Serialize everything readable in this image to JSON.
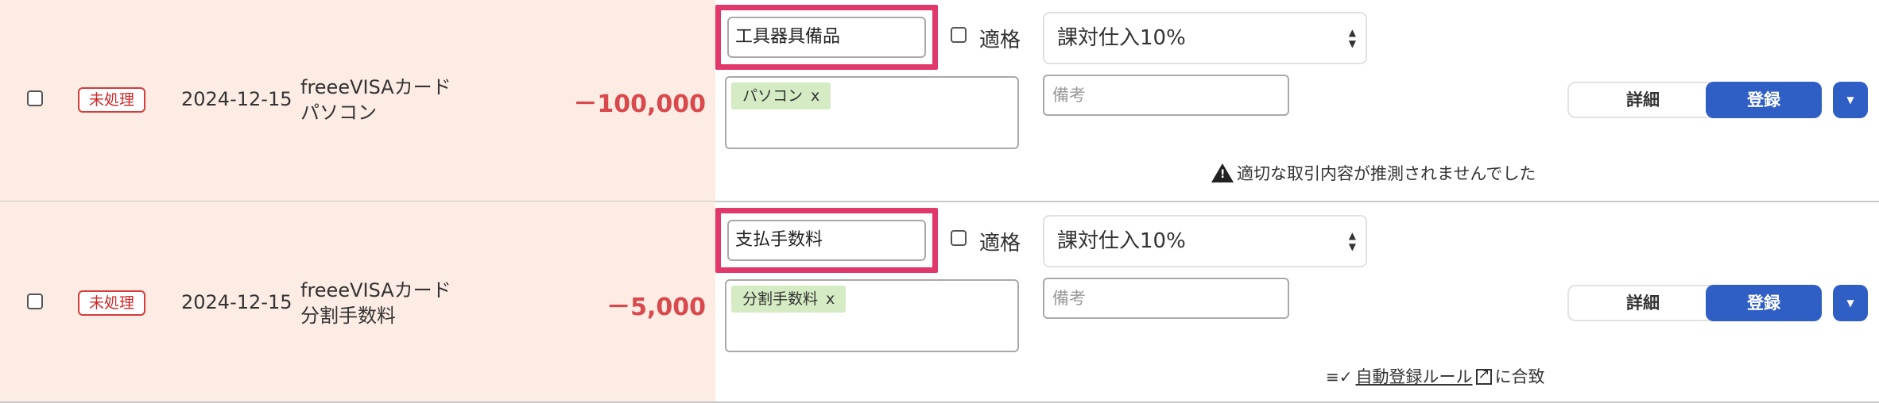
{
  "rows": [
    {
      "status": "未処理",
      "date": "2024-12-15",
      "desc_line1": "freeeVISAカード",
      "desc_line2": "パソコン",
      "amount": "－100,000",
      "account": "工具器具備品",
      "tekikaku_label": "適格",
      "tax": "課対仕入10%",
      "tag": "パソコン",
      "tag_remove": "x",
      "memo_placeholder": "備考",
      "detail_label": "詳細",
      "register_label": "登録",
      "note": "適切な取引内容が推測されませんでした"
    },
    {
      "status": "未処理",
      "date": "2024-12-15",
      "desc_line1": "freeeVISAカード",
      "desc_line2": "分割手数料",
      "amount": "－5,000",
      "account": "支払手数料",
      "tekikaku_label": "適格",
      "tax": "課対仕入10%",
      "tag": "分割手数料",
      "tag_remove": "x",
      "memo_placeholder": "備考",
      "detail_label": "詳細",
      "register_label": "登録",
      "rule_link": "自動登録ルール",
      "rule_suffix": "に合致"
    }
  ],
  "icons": {
    "warning": "warning-icon",
    "external_link": "external-link-icon",
    "dropdown": "chevron-down-icon",
    "rule": "list-check-icon"
  },
  "colors": {
    "row_left_bg": "#fcece3",
    "amount": "#d9484d",
    "highlight_border": "#e0386a",
    "primary_button": "#2f5ec4",
    "tag_bg": "#d4ebc3"
  }
}
